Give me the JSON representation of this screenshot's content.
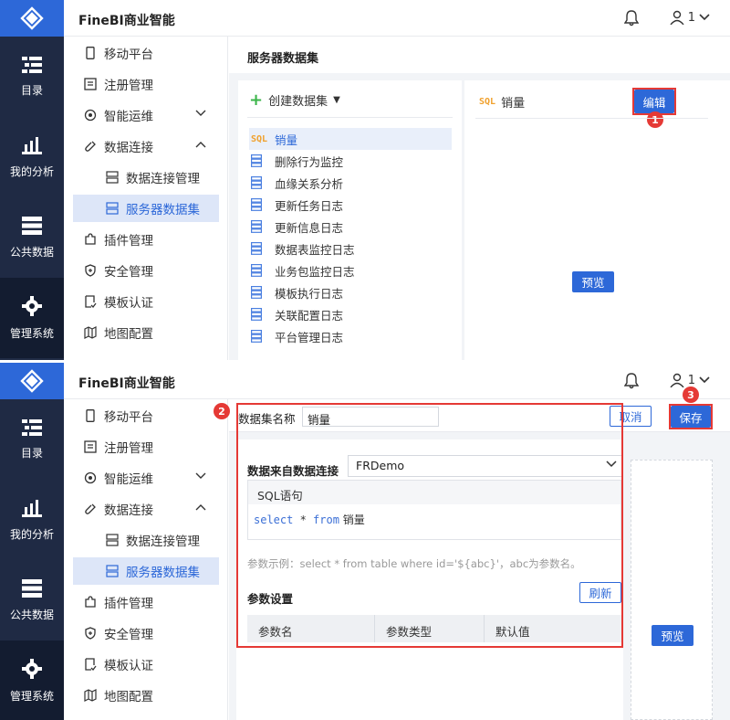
{
  "app": {
    "title": "FineBI商业智能",
    "user_count": "1"
  },
  "nav": [
    "目录",
    "我的分析",
    "公共数据",
    "管理系统"
  ],
  "sidebar": {
    "items": [
      "移动平台",
      "注册管理",
      "智能运维",
      "数据连接",
      "数据连接管理",
      "服务器数据集",
      "插件管理",
      "安全管理",
      "模板认证",
      "地图配置"
    ]
  },
  "panel1": {
    "breadcrumb": "服务器数据集",
    "create_label": "创建数据集",
    "sql_badge": "SQL",
    "datasets": [
      "销量",
      "删除行为监控",
      "血缘关系分析",
      "更新任务日志",
      "更新信息日志",
      "数据表监控日志",
      "业务包监控日志",
      "模板执行日志",
      "关联配置日志",
      "平台管理日志"
    ],
    "preview_title": "销量",
    "edit_label": "编辑",
    "preview_label": "预览"
  },
  "panel2": {
    "name_label": "数据集名称",
    "name_value": "销量",
    "cancel_label": "取消",
    "save_label": "保存",
    "source_label": "数据来自数据连接",
    "source_value": "FRDemo",
    "sql_header": "SQL语句",
    "sql_kw_select": "select",
    "sql_star": " * ",
    "sql_kw_from": "from",
    "sql_table": " 销量",
    "hint": "参数示例：select * from table where id='${abc}'，abc为参数名。",
    "param_label": "参数设置",
    "refresh_label": "刷新",
    "columns": [
      "参数名",
      "参数类型",
      "默认值"
    ],
    "preview_label": "预览"
  },
  "badges": [
    "1",
    "2",
    "3"
  ],
  "colors": {
    "brand": "#2d68d8",
    "nav_bg": "#1f2a44",
    "highlight": "#e53935"
  }
}
